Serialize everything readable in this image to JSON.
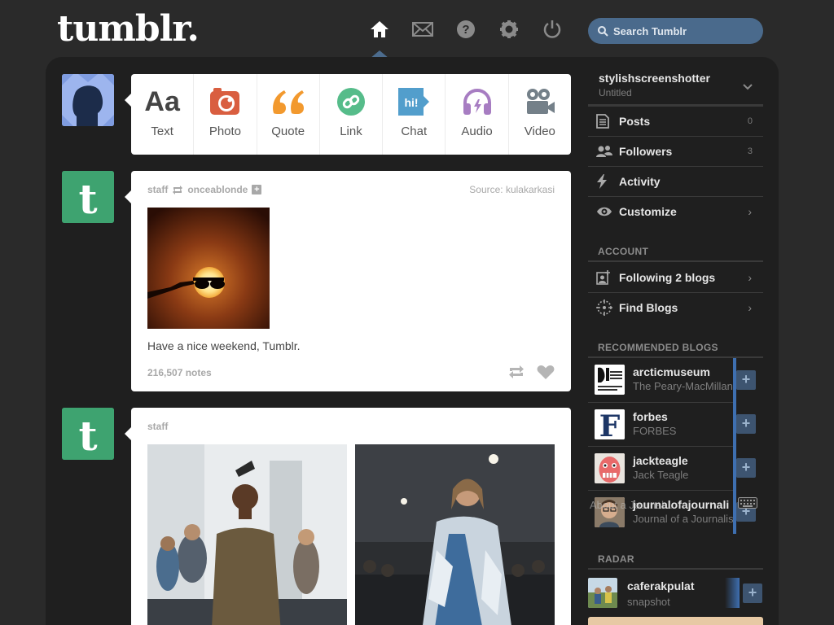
{
  "header": {
    "logo": "tumblr.",
    "nav": [
      "home-icon",
      "mail-icon",
      "help-icon",
      "gear-icon",
      "power-icon"
    ],
    "search_placeholder": "Search Tumblr"
  },
  "post_types": [
    {
      "label": "Text",
      "icon": "text-icon",
      "color": "#444444"
    },
    {
      "label": "Photo",
      "icon": "camera-icon",
      "color": "#d95e40"
    },
    {
      "label": "Quote",
      "icon": "quote-icon",
      "color": "#f2992e"
    },
    {
      "label": "Link",
      "icon": "link-icon",
      "color": "#56bc8a"
    },
    {
      "label": "Chat",
      "icon": "chat-icon",
      "color": "#529ecc"
    },
    {
      "label": "Audio",
      "icon": "headphones-icon",
      "color": "#a77dc2"
    },
    {
      "label": "Video",
      "icon": "video-camera-icon",
      "color": "#748089"
    }
  ],
  "posts": [
    {
      "author": "staff",
      "reblogged_from": "onceablonde",
      "source_label": "Source:",
      "source": "kulakarkasi",
      "caption": "Have a nice weekend, Tumblr.",
      "notes": "216,507 notes"
    },
    {
      "author": "staff"
    }
  ],
  "sidebar": {
    "blog_name": "stylishscreenshotter",
    "blog_title": "Untitled",
    "items": [
      {
        "label": "Posts",
        "count": "0",
        "icon": "posts-icon"
      },
      {
        "label": "Followers",
        "count": "3",
        "icon": "followers-icon"
      },
      {
        "label": "Activity",
        "icon": "lightning-icon"
      },
      {
        "label": "Customize",
        "icon": "eye-icon"
      }
    ],
    "account_heading": "ACCOUNT",
    "account_items": [
      {
        "label": "Following 2 blogs",
        "icon": "following-icon"
      },
      {
        "label": "Find Blogs",
        "icon": "find-blogs-icon"
      }
    ],
    "recommended_heading": "RECOMMENDED BLOGS",
    "recommended": [
      {
        "name": "arcticmuseum",
        "title": "The Peary-MacMillan"
      },
      {
        "name": "forbes",
        "title": "FORBES"
      },
      {
        "name": "jackteagle",
        "title": "Jack Teagle"
      },
      {
        "name": "journalofajournali",
        "title": "Journal of a Journalis",
        "overlay_text": "About a Journal..."
      }
    ],
    "radar_heading": "RADAR",
    "radar": {
      "name": "caferakpulat",
      "type": "snapshot"
    }
  },
  "colors": {
    "background": "#2a2a2a",
    "accent": "#4a6a8c",
    "tumblr_green": "#3ea370"
  }
}
